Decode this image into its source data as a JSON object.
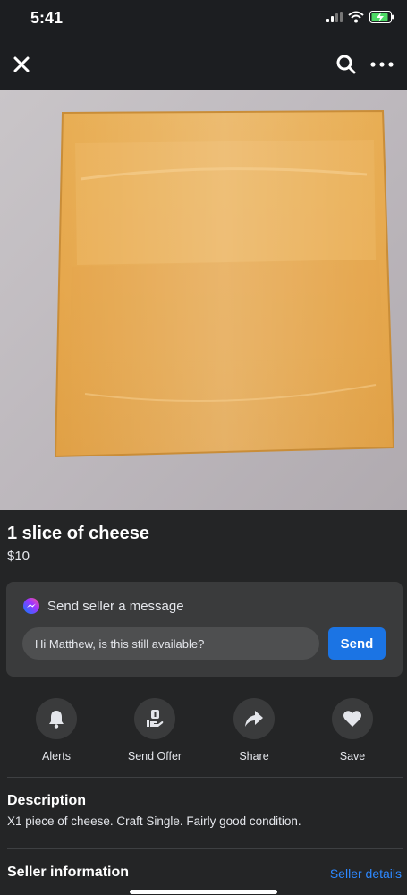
{
  "status_bar": {
    "time": "5:41"
  },
  "listing": {
    "title": "1 slice of cheese",
    "price": "$10"
  },
  "message": {
    "header_label": "Send seller a message",
    "input_value": "Hi Matthew, is this still available?",
    "send_label": "Send"
  },
  "actions": [
    {
      "label": "Alerts",
      "icon": "bell-icon"
    },
    {
      "label": "Send Offer",
      "icon": "offer-icon"
    },
    {
      "label": "Share",
      "icon": "share-icon"
    },
    {
      "label": "Save",
      "icon": "heart-icon"
    }
  ],
  "description": {
    "heading": "Description",
    "text": "X1 piece of cheese. Craft Single.  Fairly good condition."
  },
  "seller": {
    "heading": "Seller information",
    "link": "Seller details"
  },
  "colors": {
    "background": "#242526",
    "card": "#3a3b3c",
    "accent": "#1b74e4",
    "link": "#2d88ff"
  }
}
